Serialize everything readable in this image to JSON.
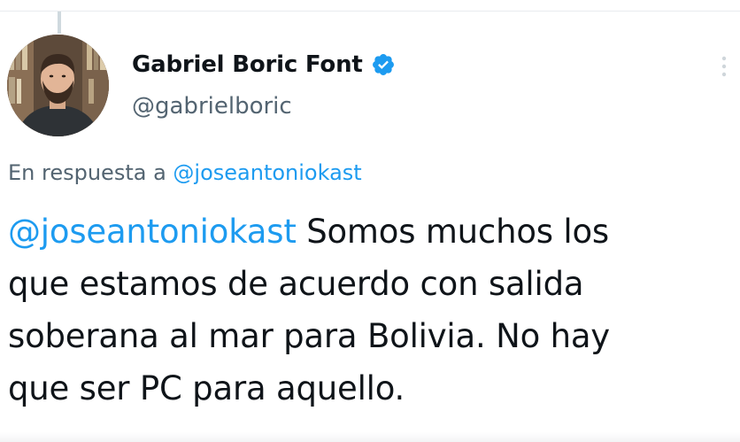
{
  "author": {
    "display_name": "Gabriel Boric Font",
    "handle": "@gabrielboric",
    "verified": true
  },
  "reply_context": {
    "prefix": "En respuesta a",
    "mention": "@joseantoniokast"
  },
  "tweet": {
    "mention": "@joseantoniokast",
    "line1_rest": " Somos muchos los",
    "line2": "que estamos de acuerdo con salida",
    "line3": "soberana al mar para Bolivia. No hay",
    "line4": "que ser PC para aquello."
  },
  "icons": {
    "verified": "verified-badge-icon",
    "more": "more-options-icon"
  },
  "colors": {
    "accent": "#1d9bf0",
    "text": "#0f1419",
    "secondary": "#536471"
  }
}
